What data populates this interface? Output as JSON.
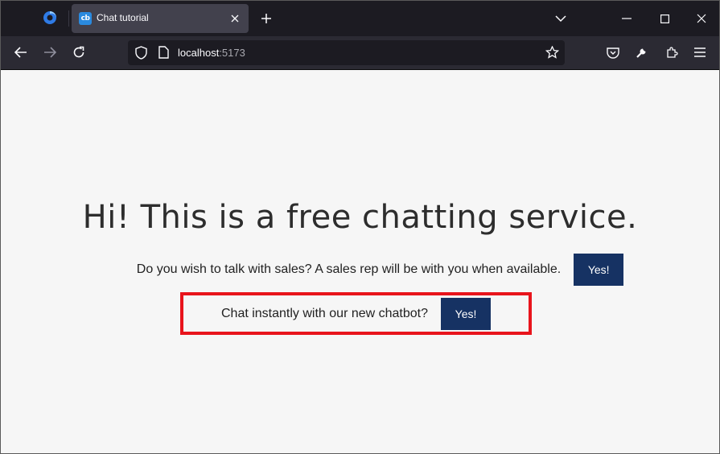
{
  "browser": {
    "tab": {
      "favicon_text": "cb",
      "title": "Chat tutorial"
    },
    "url": {
      "host": "localhost",
      "port": ":5173"
    }
  },
  "page": {
    "headline": "Hi! This is a free chatting service.",
    "sales": {
      "text": "Do you wish to talk with sales? A sales rep will be with you when available.",
      "button": "Yes!"
    },
    "chatbot": {
      "text": "Chat instantly with our new chatbot?",
      "button": "Yes!"
    }
  },
  "colors": {
    "button_bg": "#163263",
    "highlight_border": "#e8141c",
    "page_bg": "#f6f6f6"
  }
}
